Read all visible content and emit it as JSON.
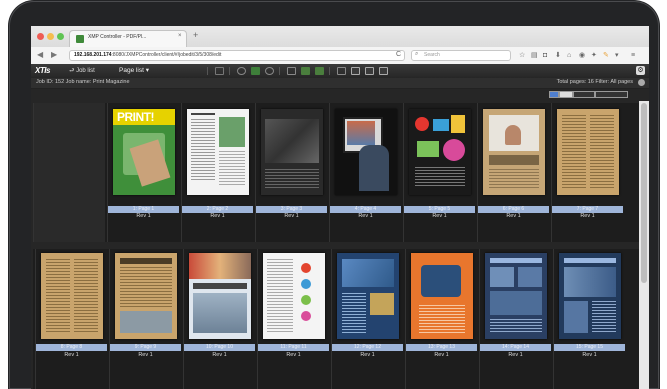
{
  "browser": {
    "tab_title": "XMP Controller - PDF/Pl...",
    "tab_close": "×",
    "new_tab": "+",
    "url_prefix": "192.168.201.174",
    "url_rest": ":8080/JXMPController/client/#/jobedit/3/5/308/edit",
    "search_placeholder": "Search",
    "reload_glyph": "C"
  },
  "app": {
    "logo": "XTIs",
    "job_list_label": "Job list",
    "page_list_label": "Page list ▾",
    "job_info": "Job ID: 152 Job name: Print Magazine",
    "pages_info": "Total pages: 16 Filter: All pages"
  },
  "rows": [
    {
      "pages": [
        {
          "label": "",
          "rev": "",
          "empty": true
        },
        {
          "label": "1: Page 1",
          "rev": "Rev 1",
          "theme": "print"
        },
        {
          "label": "2: Page 2",
          "rev": "Rev 1",
          "theme": "text-white"
        },
        {
          "label": "3: Page 3",
          "rev": "Rev 1",
          "theme": "dark-photo"
        },
        {
          "label": "4: Page 4",
          "rev": "Rev 1",
          "theme": "tablet"
        },
        {
          "label": "5: Page 5",
          "rev": "Rev 1",
          "theme": "color-collage"
        },
        {
          "label": "6: Page 6",
          "rev": "Rev 1",
          "theme": "kraft-photo"
        },
        {
          "label": "7: Page 7",
          "rev": "Rev 1",
          "theme": "kraft-text"
        }
      ]
    },
    {
      "pages": [
        {
          "label": "8: Page 8",
          "rev": "Rev 1",
          "theme": "kraft-text"
        },
        {
          "label": "9: Page 9",
          "rev": "Rev 1",
          "theme": "kraft-text-photo"
        },
        {
          "label": "10: Page 10",
          "rev": "Rev 1",
          "theme": "machines"
        },
        {
          "label": "11: Page 11",
          "rev": "Rev 1",
          "theme": "white-circles"
        },
        {
          "label": "12: Page 12",
          "rev": "Rev 1",
          "theme": "blue-collage"
        },
        {
          "label": "13: Page 13",
          "rev": "Rev 1",
          "theme": "orange"
        },
        {
          "label": "14: Page 14",
          "rev": "Rev 1",
          "theme": "blue-photos"
        },
        {
          "label": "15: Page 15",
          "rev": "Rev 1",
          "theme": "blue-photos2"
        }
      ]
    }
  ],
  "colors": {
    "accent_bar": "#9fb5d9",
    "selected_bar": "#6a8ecf"
  }
}
